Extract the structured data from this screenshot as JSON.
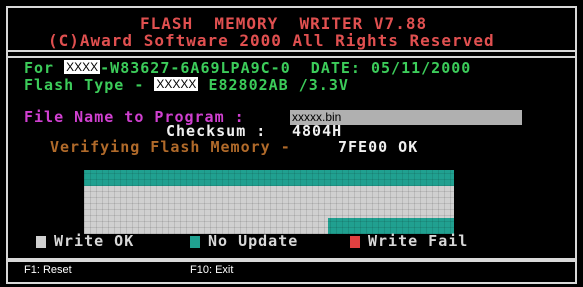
{
  "header": {
    "line1": "FLASH  MEMORY  WRITER V7.88",
    "line2": "(C)Award Software 2000 All Rights Reserved"
  },
  "chip": {
    "for_prefix": "For",
    "for_value": "XXXX",
    "for_suffix": "-W83627-6A69LPA9C-0",
    "date_label": "DATE:",
    "date_value": "05/11/2000",
    "flash_type_label": "Flash Type -",
    "flash_type_value": "XXXXX",
    "flash_type_suffix": "E82802AB /3.3V"
  },
  "program": {
    "file_label": "File Name to Program :",
    "file_value": "xxxxx.bin",
    "checksum_label": "Checksum :",
    "checksum_value": "4804H",
    "verify_label": "Verifying Flash Memory -",
    "verify_value": "7FE00 OK"
  },
  "progress": {
    "write_ok_fraction": 0.66,
    "colors": {
      "write_ok": "#d0d0d0",
      "no_update": "#20a090",
      "write_fail": "#e04040"
    }
  },
  "legend": {
    "write_ok": "Write OK",
    "no_update": "No Update",
    "write_fail": "Write Fail"
  },
  "footer": {
    "reset": "F1: Reset",
    "exit": "F10: Exit"
  }
}
